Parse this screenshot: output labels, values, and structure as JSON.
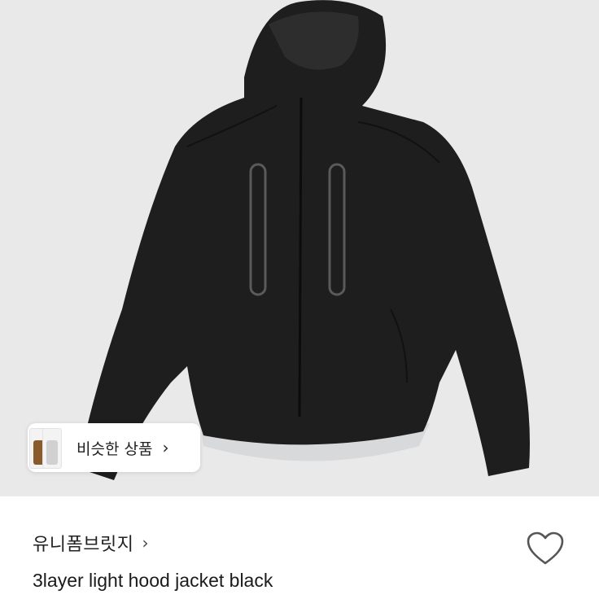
{
  "product_image": {
    "alt_icon": "jacket-photo"
  },
  "similar": {
    "label": "비슷한 상품",
    "chevron": "›"
  },
  "shop": {
    "name": "유니폼브릿지",
    "chevron": "›"
  },
  "product": {
    "title": "3layer light hood jacket black"
  },
  "icons": {
    "like": "heart-outline-icon"
  },
  "colors": {
    "photo_bg": "#e9e9e9",
    "jacket": "#1e1e1e",
    "text": "#222222"
  }
}
